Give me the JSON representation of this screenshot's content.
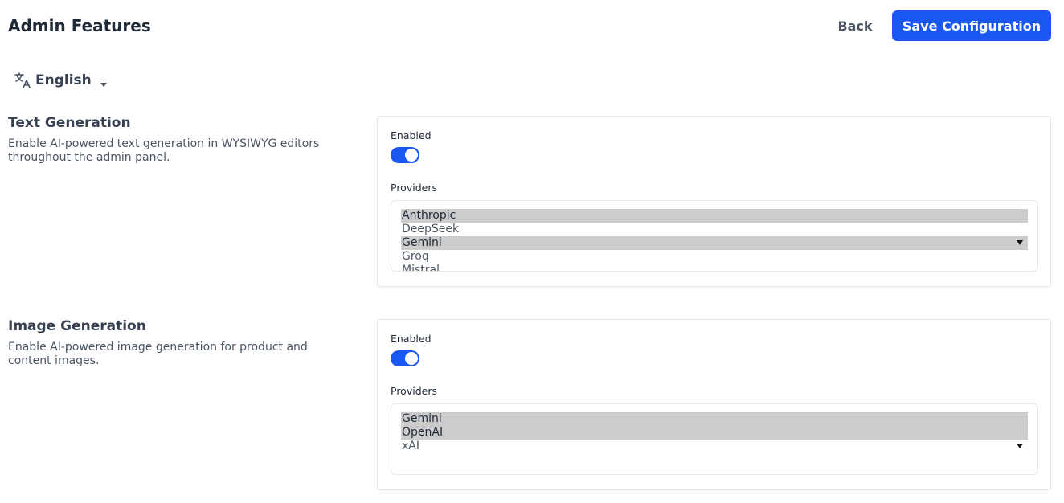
{
  "header": {
    "title": "Admin Features",
    "back_label": "Back",
    "save_label": "Save Configuration"
  },
  "language": {
    "icon": "translate-icon",
    "selected": "English"
  },
  "colors": {
    "accent": "#1a56f0",
    "selected_option": "#cccccc"
  },
  "sections": [
    {
      "title": "Text Generation",
      "description": "Enable AI-powered text generation in WYSIWYG editors throughout the admin panel.",
      "enabled_label": "Enabled",
      "enabled": true,
      "providers_label": "Providers",
      "providers": [
        {
          "label": "Anthropic",
          "selected": true
        },
        {
          "label": "DeepSeek",
          "selected": false
        },
        {
          "label": "Gemini",
          "selected": true
        },
        {
          "label": "Groq",
          "selected": false
        },
        {
          "label": "Mistral",
          "selected": false
        }
      ]
    },
    {
      "title": "Image Generation",
      "description": "Enable AI-powered image generation for product and content images.",
      "enabled_label": "Enabled",
      "enabled": true,
      "providers_label": "Providers",
      "providers": [
        {
          "label": "Gemini",
          "selected": true
        },
        {
          "label": "OpenAI",
          "selected": true
        },
        {
          "label": "xAI",
          "selected": false
        }
      ]
    }
  ]
}
